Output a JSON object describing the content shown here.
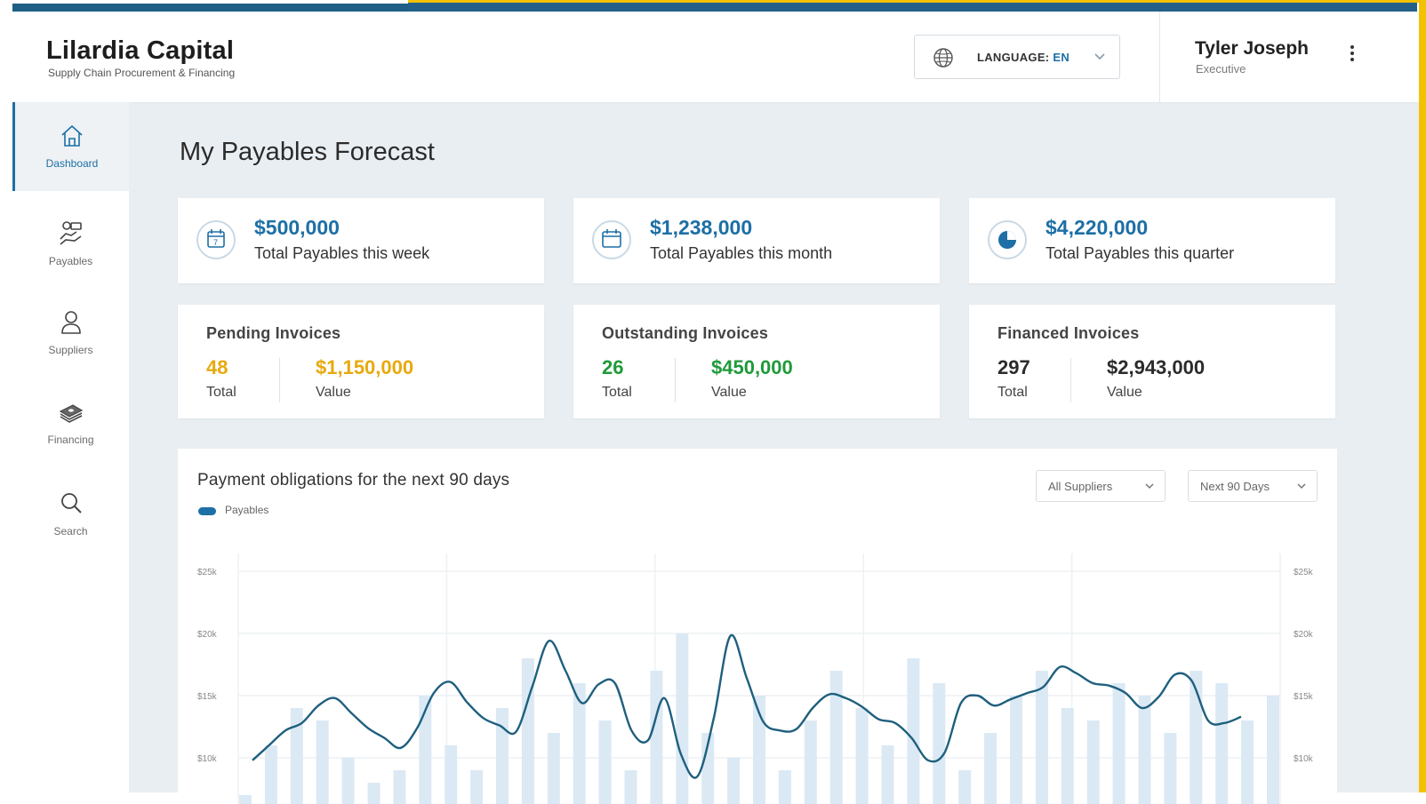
{
  "brand": {
    "title": "Lilardia Capital",
    "subtitle": "Supply Chain Procurement & Financing"
  },
  "language": {
    "prefix": "LANGUAGE:",
    "code": "EN",
    "icon": "globe-icon"
  },
  "user": {
    "name": "Tyler Joseph",
    "role": "Executive"
  },
  "sidebar": {
    "items": [
      {
        "label": "Dashboard",
        "icon": "home-icon",
        "active": true
      },
      {
        "label": "Payables",
        "icon": "payables-icon",
        "active": false
      },
      {
        "label": "Suppliers",
        "icon": "user-icon",
        "active": false
      },
      {
        "label": "Financing",
        "icon": "money-stack-icon",
        "active": false
      },
      {
        "label": "Search",
        "icon": "search-icon",
        "active": false
      }
    ]
  },
  "page_title": "My Payables Forecast",
  "totals": [
    {
      "amount": "$500,000",
      "label": "Total Payables this week",
      "icon": "calendar-week-icon"
    },
    {
      "amount": "$1,238,000",
      "label": "Total Payables this month",
      "icon": "calendar-month-icon"
    },
    {
      "amount": "$4,220,000",
      "label": "Total Payables this quarter",
      "icon": "pie-quarter-icon"
    }
  ],
  "invoices": [
    {
      "title": "Pending Invoices",
      "count": "48",
      "count_label": "Total",
      "value": "$1,150,000",
      "value_label": "Value",
      "color": "#e8a90c"
    },
    {
      "title": "Outstanding Invoices",
      "count": "26",
      "count_label": "Total",
      "value": "$450,000",
      "value_label": "Value",
      "color": "#c0181f"
    },
    {
      "title": "Financed Invoices",
      "count": "297",
      "count_label": "Total",
      "value": "$2,943,000",
      "value_label": "Value",
      "color": "#1f9a3a"
    }
  ],
  "chart": {
    "title": "Payment obligations for the next 90 days",
    "legend": "Payables",
    "filter_suppliers": "All Suppliers",
    "filter_range": "Next 90 Days"
  },
  "colors": {
    "accent": "#1d6fa5",
    "line": "#1f5f7e",
    "bar": "#dbe9f4"
  },
  "chart_data": {
    "type": "line",
    "series": [
      {
        "name": "Payables",
        "values": [
          9.8,
          11.0,
          12.2,
          12.8,
          14.2,
          14.8,
          13.6,
          12.4,
          11.6,
          10.8,
          12.4,
          15.2,
          16.1,
          14.5,
          13.2,
          12.6,
          12.1,
          15.8,
          19.4,
          17.0,
          14.4,
          15.9,
          16.0,
          12.2,
          11.4,
          14.8,
          10.3,
          8.5,
          13.2,
          19.8,
          16.4,
          12.9,
          12.2,
          12.3,
          14.0,
          15.1,
          14.8,
          14.1,
          13.1,
          12.8,
          11.6,
          9.8,
          10.4,
          14.4,
          15.0,
          14.2,
          14.7,
          15.2,
          15.7,
          17.3,
          16.8,
          16.0,
          15.8,
          15.2,
          14.0,
          14.9,
          16.7,
          16.2,
          13.0,
          12.8,
          13.3
        ]
      }
    ],
    "bars": [
      7,
      11,
      14,
      13,
      10,
      8,
      9,
      15,
      11,
      9,
      14,
      18,
      12,
      16,
      13,
      9,
      17,
      20,
      12,
      10,
      15,
      9,
      13,
      17,
      14,
      11,
      18,
      16,
      9,
      12,
      15,
      17,
      14,
      13,
      16,
      15,
      12,
      17,
      16,
      13,
      15
    ],
    "ylim": [
      9,
      25
    ],
    "yticks": [
      "$25k",
      "$20k",
      "$15k",
      "$10k"
    ]
  }
}
